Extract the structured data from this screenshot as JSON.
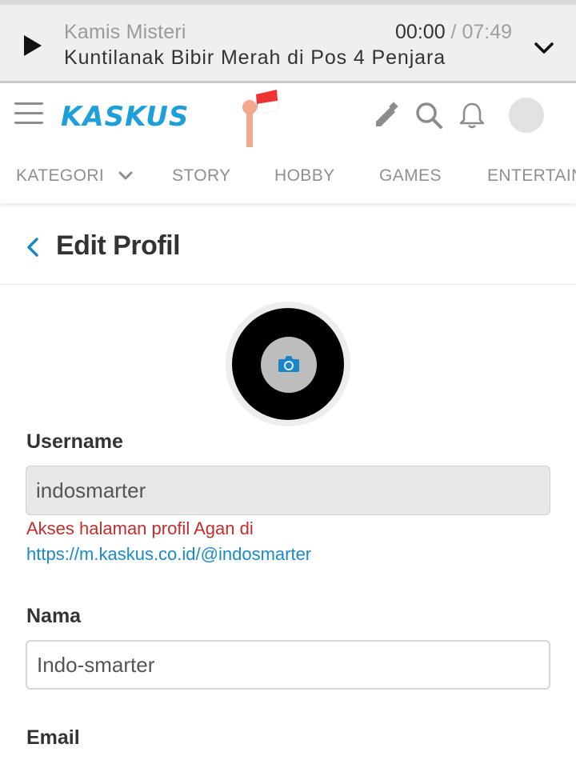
{
  "player": {
    "subtitle": "Kamis Misteri",
    "title": "Kuntilanak Bibir Merah di Pos 4 Penjara",
    "current_time": "00:00",
    "separator": " / ",
    "duration": "07:49",
    "play_icon": "play-icon",
    "collapse_icon": "chevron-down-icon"
  },
  "header": {
    "logo_part1": "KASKUS",
    "icons": [
      "pencil-icon",
      "search-icon",
      "bell-icon",
      "avatar"
    ]
  },
  "categories": {
    "items": [
      "KATEGORI",
      "STORY",
      "HOBBY",
      "GAMES",
      "ENTERTAIN"
    ]
  },
  "page": {
    "title": "Edit Profil",
    "back_icon": "chevron-left-icon"
  },
  "form": {
    "username_label": "Username",
    "username_value": "indosmarter",
    "hint_text": "Akses halaman profil Agan di",
    "profile_link": "https://m.kaskus.co.id/@indosmarter",
    "name_label": "Nama",
    "name_value": "Indo-smarter",
    "email_label": "Email"
  },
  "colors": {
    "brand_blue": "#1d9fd9",
    "brand_orange": "#f4a021",
    "link": "#1a8ac9",
    "hint_red": "#c62c2c",
    "camera_icon": "#1a86c8"
  }
}
